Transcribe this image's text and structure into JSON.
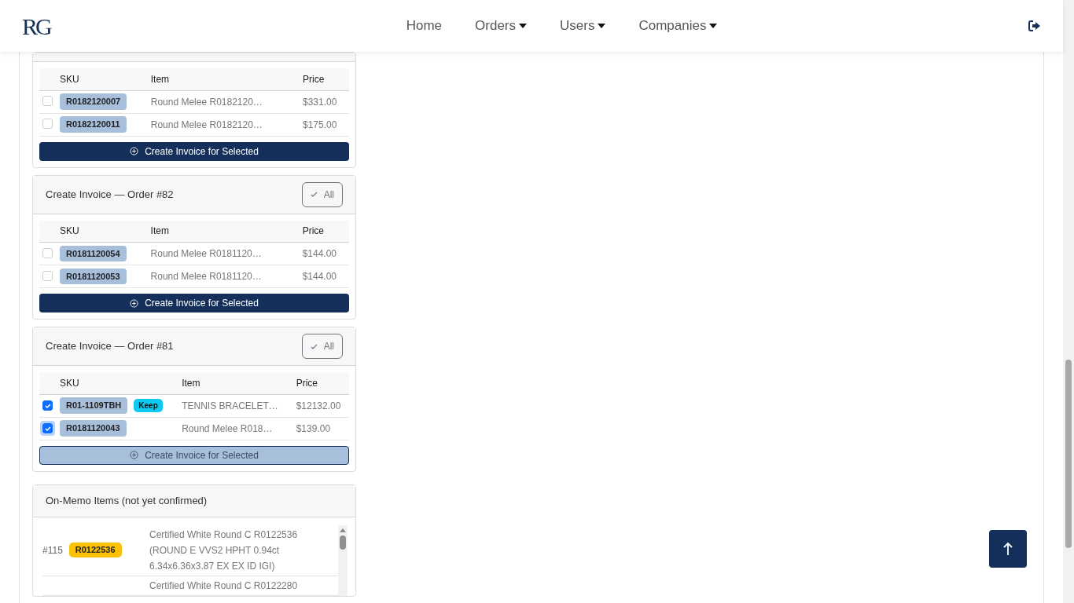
{
  "brand": {
    "logo": "RG"
  },
  "nav": [
    {
      "label": "Home",
      "dropdown": false
    },
    {
      "label": "Orders",
      "dropdown": true
    },
    {
      "label": "Users",
      "dropdown": true
    },
    {
      "label": "Companies",
      "dropdown": true
    }
  ],
  "invoice_cards": [
    {
      "columns": [
        "SKU",
        "Item",
        "Price"
      ],
      "rows": [
        {
          "checked": false,
          "focused": false,
          "sku": "R0182120007",
          "item": "Round Melee R0182120…",
          "price": "$331.00"
        },
        {
          "checked": false,
          "focused": false,
          "sku": "R0182120011",
          "item": "Round Melee R0182120…",
          "price": "$175.00"
        }
      ],
      "button": {
        "label": "Create Invoice for Selected",
        "highlighted": false
      }
    },
    {
      "title": "Create Invoice — Order #82",
      "all_button": "All",
      "columns": [
        "SKU",
        "Item",
        "Price"
      ],
      "rows": [
        {
          "checked": false,
          "focused": false,
          "sku": "R0181120054",
          "item": "Round Melee R0181120…",
          "price": "$144.00"
        },
        {
          "checked": false,
          "focused": false,
          "sku": "R0181120053",
          "item": "Round Melee R0181120…",
          "price": "$144.00"
        }
      ],
      "button": {
        "label": "Create Invoice for Selected",
        "highlighted": false
      }
    },
    {
      "title": "Create Invoice — Order #81",
      "all_button": "All",
      "columns": [
        "SKU",
        "Item",
        "Price"
      ],
      "rows": [
        {
          "checked": true,
          "focused": false,
          "sku": "R01-1109TBH",
          "tag": "Keep",
          "item": "TENNIS BRACELET…",
          "price": "$12132.00"
        },
        {
          "checked": true,
          "focused": true,
          "sku": "R0181120043",
          "item": "Round Melee R018…",
          "price": "$139.00"
        }
      ],
      "button": {
        "label": "Create Invoice for Selected",
        "highlighted": true
      }
    }
  ],
  "memo": {
    "title": "On-Memo Items (not yet confirmed)",
    "rows": [
      {
        "number": "#115",
        "sku": "R0122536",
        "description": "Certified White Round C R0122536 (ROUND E VVS2 HPHT 0.94ct 6.34x6.36x3.87 EX EX ID IGI)"
      },
      {
        "description": "Certified White Round C R0122280"
      }
    ]
  }
}
